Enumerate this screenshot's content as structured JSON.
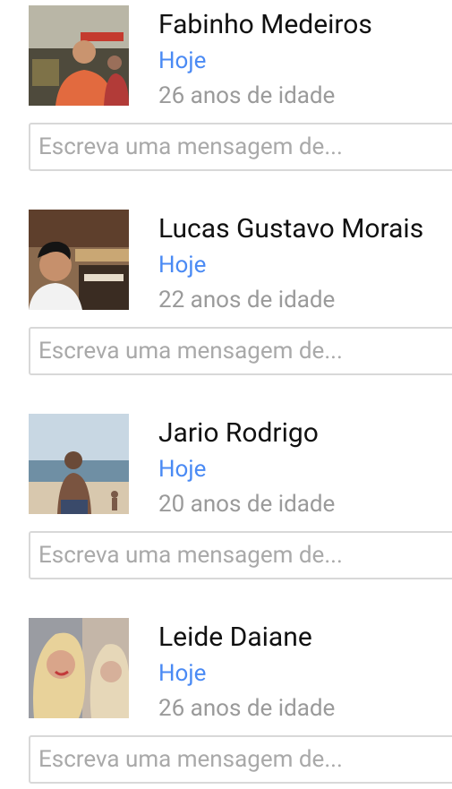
{
  "friends": [
    {
      "name": "Fabinho Medeiros",
      "when": "Hoje",
      "age": "26 anos de idade",
      "placeholder": "Escreva uma mensagem de..."
    },
    {
      "name": "Lucas Gustavo Morais",
      "when": "Hoje",
      "age": "22 anos de idade",
      "placeholder": "Escreva uma mensagem de..."
    },
    {
      "name": "Jario Rodrigo",
      "when": "Hoje",
      "age": "20 anos de idade",
      "placeholder": "Escreva uma mensagem de..."
    },
    {
      "name": "Leide Daiane",
      "when": "Hoje",
      "age": "26 anos de idade",
      "placeholder": "Escreva uma mensagem de..."
    }
  ],
  "colors": {
    "name": "#111111",
    "when_accent": "#4a8af4",
    "age": "#9a9a9a",
    "input_border": "#d8d8d8",
    "placeholder": "#a9a9a9"
  }
}
